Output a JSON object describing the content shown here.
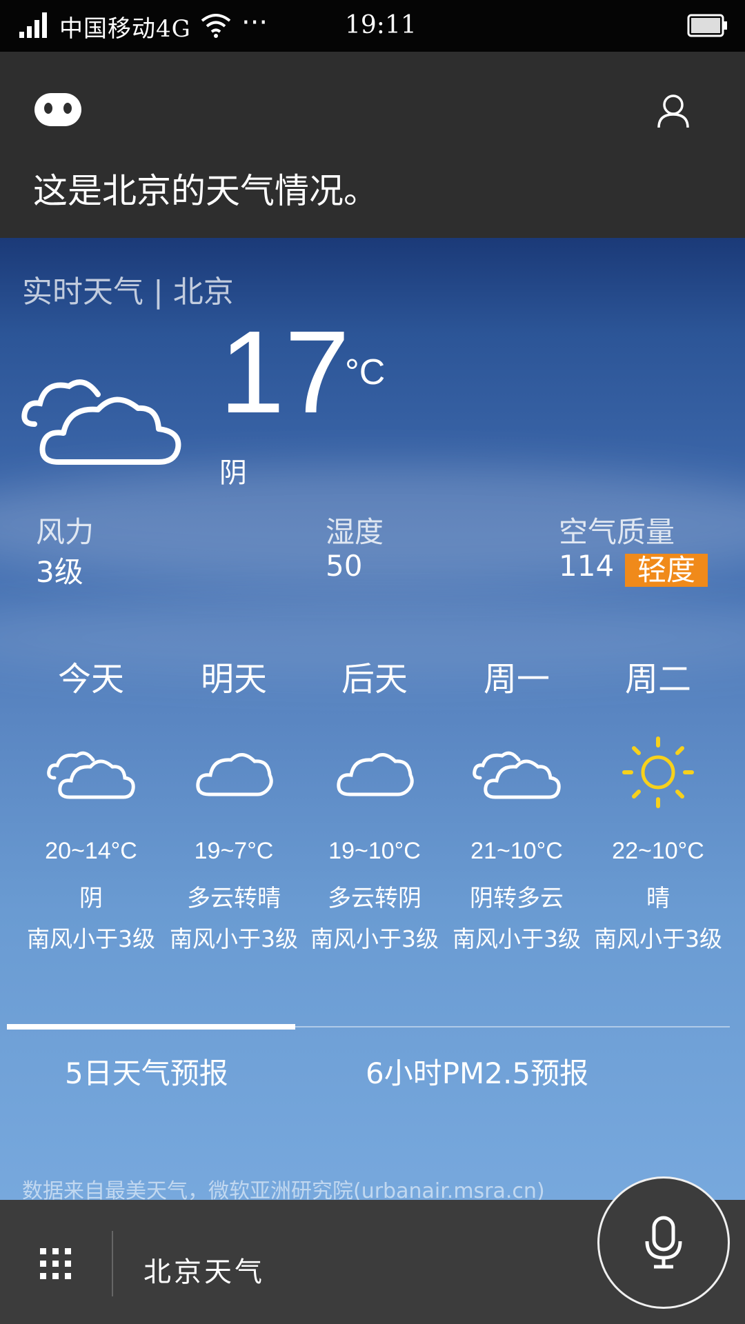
{
  "status_bar": {
    "carrier": "中国移动4G",
    "more": "···",
    "time": "19:11"
  },
  "assistant": {
    "reply": "这是北京的天气情况。"
  },
  "weather": {
    "title": "实时天气 | 北京",
    "temperature": "17",
    "unit": "°C",
    "condition": "阴",
    "wind_label": "风力",
    "wind_value": "3级",
    "humidity_label": "湿度",
    "humidity_value": "50",
    "aqi_label": "空气质量",
    "aqi_value": "114",
    "aqi_level": "轻度",
    "aqi_level_color": "#f08a1a",
    "forecast": [
      {
        "day": "今天",
        "icon": "partly-cloudy-icon",
        "temp": "20~14°C",
        "cond": "阴",
        "wind": "南风小于3级"
      },
      {
        "day": "明天",
        "icon": "cloud-icon",
        "temp": "19~7°C",
        "cond": "多云转晴",
        "wind": "南风小于3级"
      },
      {
        "day": "后天",
        "icon": "cloud-icon",
        "temp": "19~10°C",
        "cond": "多云转阴",
        "wind": "南风小于3级"
      },
      {
        "day": "周一",
        "icon": "partly-cloudy-icon",
        "temp": "21~10°C",
        "cond": "阴转多云",
        "wind": "南风小于3级"
      },
      {
        "day": "周二",
        "icon": "sun-icon",
        "temp": "22~10°C",
        "cond": "晴",
        "wind": "南风小于3级"
      }
    ],
    "tabs": [
      "5日天气预报",
      "6小时PM2.5预报"
    ],
    "active_tab": 0,
    "source": "数据来自最美天气，微软亚洲研究院(urbanair.msra.cn)"
  },
  "bottom_bar": {
    "query": "北京天气"
  }
}
